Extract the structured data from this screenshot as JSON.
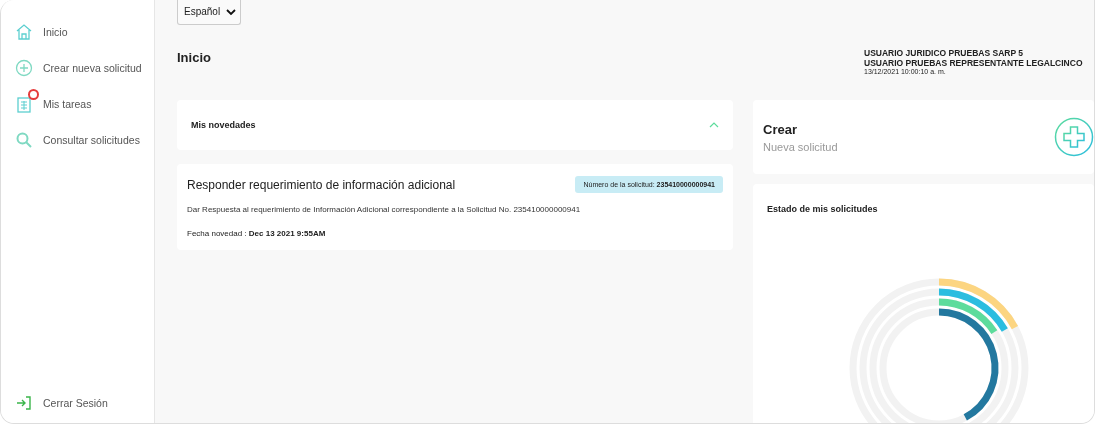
{
  "sidebar": {
    "items": [
      {
        "label": "Inicio",
        "kind": "home",
        "badge": false
      },
      {
        "label": "Crear nueva solicitud",
        "kind": "plus",
        "badge": false
      },
      {
        "label": "Mis tareas",
        "kind": "tasks",
        "badge": true
      },
      {
        "label": "Consultar solicitudes",
        "kind": "search",
        "badge": false
      }
    ],
    "logout": {
      "label": "Cerrar Sesión"
    }
  },
  "language": {
    "value": "Español"
  },
  "page_title": "Inicio",
  "user": {
    "lines": [
      "USUARIO JURIDICO PRUEBAS SARP 5",
      "USUARIO PRUEBAS REPRESENTANTE LEGALCINCO"
    ],
    "timestamp": "13/12/2021 10:00:10 a. m."
  },
  "news": {
    "title": "Mis novedades",
    "expanded": true,
    "items": [
      {
        "title": "Responder requerimiento de información adicional",
        "request_label": "Número de la solicitud:",
        "request_number": "235410000000941",
        "description": "Dar Respuesta al requerimiento de Información Adicional correspondiente a la Solicitud No. 235410000000941",
        "date_label": "Fecha novedad :",
        "date": "Dec 13 2021 9:55AM"
      }
    ]
  },
  "create": {
    "title": "Crear",
    "subtitle": "Nueva solicitud"
  },
  "status_chart": {
    "title": "Estado de mis solicitudes"
  }
}
